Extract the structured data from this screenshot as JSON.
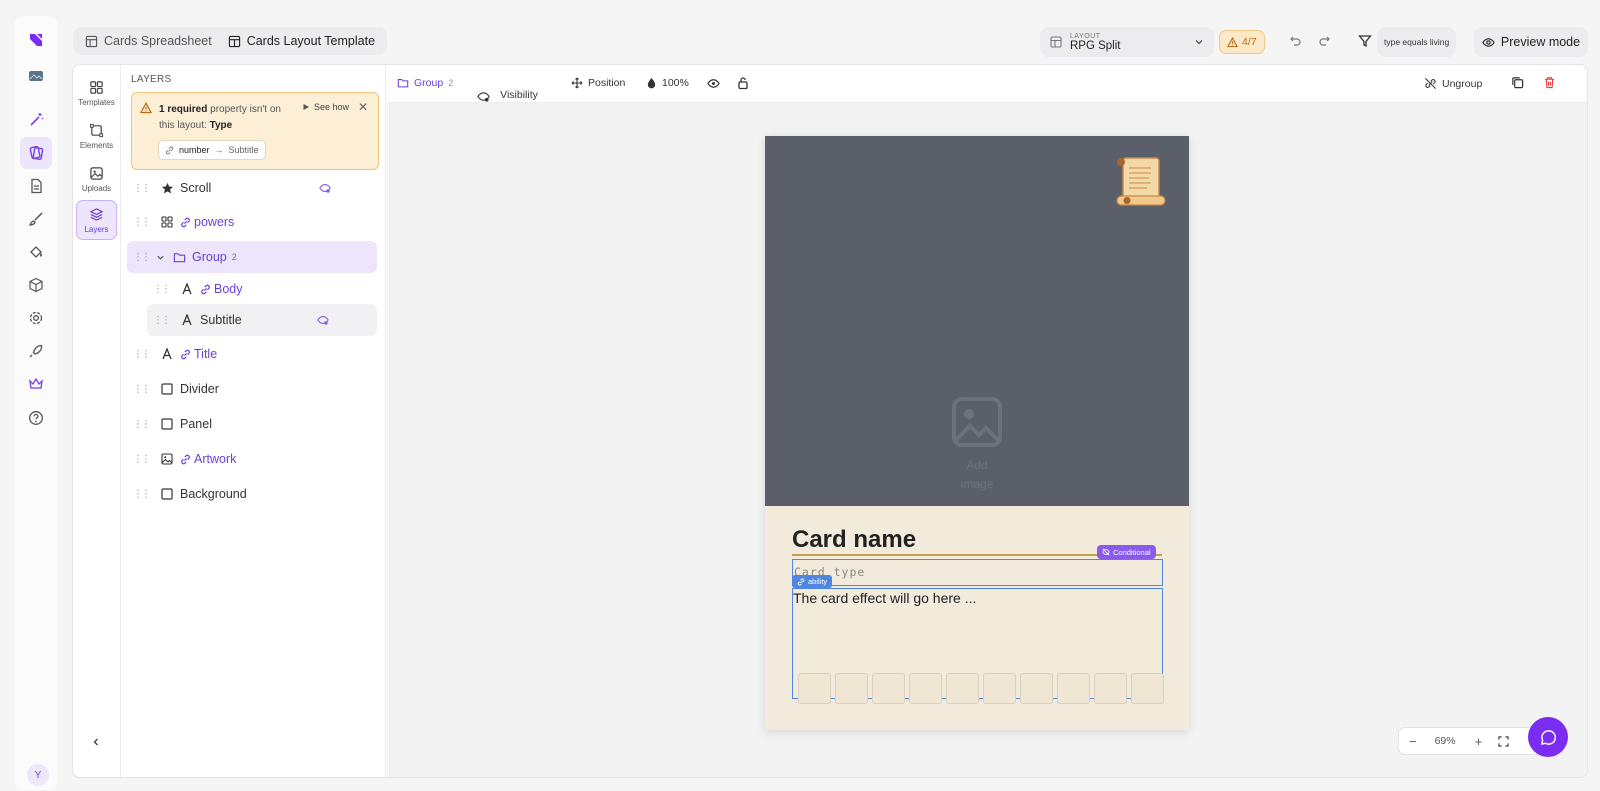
{
  "tabs": [
    {
      "label": "Cards Spreadsheet",
      "icon": "table-icon"
    },
    {
      "label": "Cards Layout Template",
      "icon": "layout-icon"
    }
  ],
  "layout_select": {
    "caption": "LAYOUT",
    "value": "RPG Split"
  },
  "warnings_badge": "4/7",
  "filter_text": "type equals living",
  "preview_button": "Preview mode",
  "tools": [
    {
      "label": "Templates"
    },
    {
      "label": "Elements"
    },
    {
      "label": "Uploads"
    },
    {
      "label": "Layers"
    }
  ],
  "layers_panel": {
    "title": "LAYERS",
    "alert": {
      "count": "1 required",
      "text": " property isn't on this layout: ",
      "property": "Type",
      "see_how": "See how",
      "chip_from": "number",
      "chip_arrow": "→",
      "chip_to": "Subtitle"
    },
    "items": [
      {
        "label": "Scroll"
      },
      {
        "label": "powers"
      },
      {
        "label": "Group",
        "count": "2"
      },
      {
        "label": "Body"
      },
      {
        "label": "Subtitle"
      },
      {
        "label": "Title"
      },
      {
        "label": "Divider"
      },
      {
        "label": "Panel"
      },
      {
        "label": "Artwork"
      },
      {
        "label": "Background"
      }
    ]
  },
  "canvas_toolbar": {
    "group_label": "Group",
    "group_count": "2",
    "visibility_rule": "Visibility rule",
    "position": "Position",
    "opacity": "100%",
    "ungroup": "Ungroup"
  },
  "card": {
    "add_image": "Add image",
    "name": "Card name",
    "conditional_badge": "Conditional",
    "type_placeholder": "Card type",
    "ability_badge": "ability",
    "effect": "The card effect will go here ..."
  },
  "zoom": {
    "value": "69%"
  },
  "user_initial": "Y",
  "accent_color": "#7a3fe0"
}
